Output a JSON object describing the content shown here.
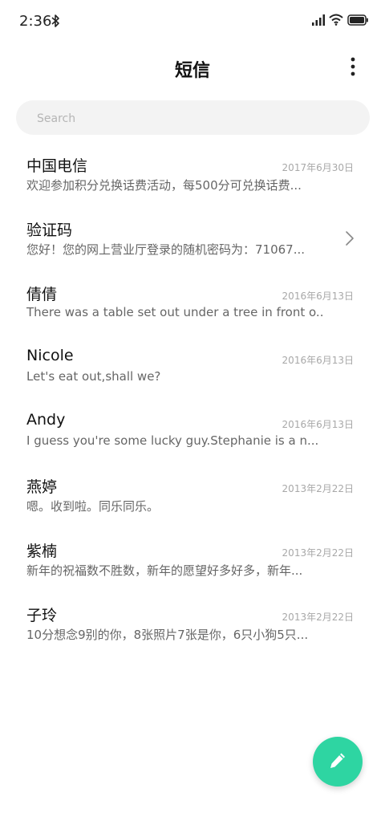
{
  "status_bar": {
    "time": "2:36",
    "icons": [
      "bluetooth-icon",
      "signal-icon",
      "wifi-icon",
      "battery-icon"
    ]
  },
  "header": {
    "title": "短信",
    "menu_icon": "more-vertical-icon"
  },
  "search": {
    "placeholder": "Search",
    "value": ""
  },
  "conversations": [
    {
      "name": "中国电信",
      "date": "2017年6月30日",
      "preview": "欢迎参加积分兑换话费活动，每500分可兑换话费..."
    },
    {
      "name": "验证码",
      "date": "",
      "preview": "您好！您的网上营业厅登录的随机密码为：71067...",
      "has_chevron": true
    },
    {
      "name": "倩倩",
      "date": "2016年6月13日",
      "preview": "There was a table set out under a tree in front o..."
    },
    {
      "name": "Nicole",
      "date": "2016年6月13日",
      "preview": "Let's eat out,shall we?"
    },
    {
      "name": "Andy",
      "date": "2016年6月13日",
      "preview": "I guess you're some lucky guy.Stephanie is a n..."
    },
    {
      "name": "燕婷",
      "date": "2013年2月22日",
      "preview": "嗯。收到啦。同乐同乐。"
    },
    {
      "name": "紫楠",
      "date": "2013年2月22日",
      "preview": "新年的祝福数不胜数，新年的愿望好多好多，新年..."
    },
    {
      "name": "子玲",
      "date": "2013年2月22日",
      "preview": "10分想念9别的你，8张照片7张是你，6只小狗5只..."
    }
  ],
  "fab": {
    "icon": "pencil-icon",
    "color": "#2ed5a2"
  }
}
